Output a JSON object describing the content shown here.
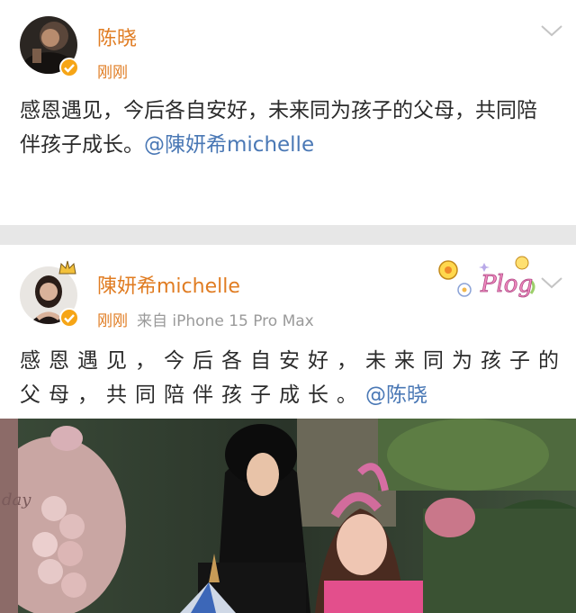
{
  "post1": {
    "username": "陈晓",
    "time": "刚刚",
    "text": "感恩遇见，今后各自安好，未来同为孩子的父母，共同陪伴孩子成长。",
    "mention": "@陳妍希michelle"
  },
  "post2": {
    "username": "陳妍希michelle",
    "time": "刚刚",
    "source": "来自 iPhone 15 Pro Max",
    "text_line1": "感恩遇见，今后各自安好，未来同为孩子的",
    "text_line2": "父母，共同陪伴孩子成长。",
    "mention": "@陈晓",
    "badge": "Plog"
  },
  "colors": {
    "name": "#e07c22",
    "mention": "#4a78b5",
    "verified": "#f6a516"
  },
  "photo": {
    "banner_fragment": "day"
  }
}
